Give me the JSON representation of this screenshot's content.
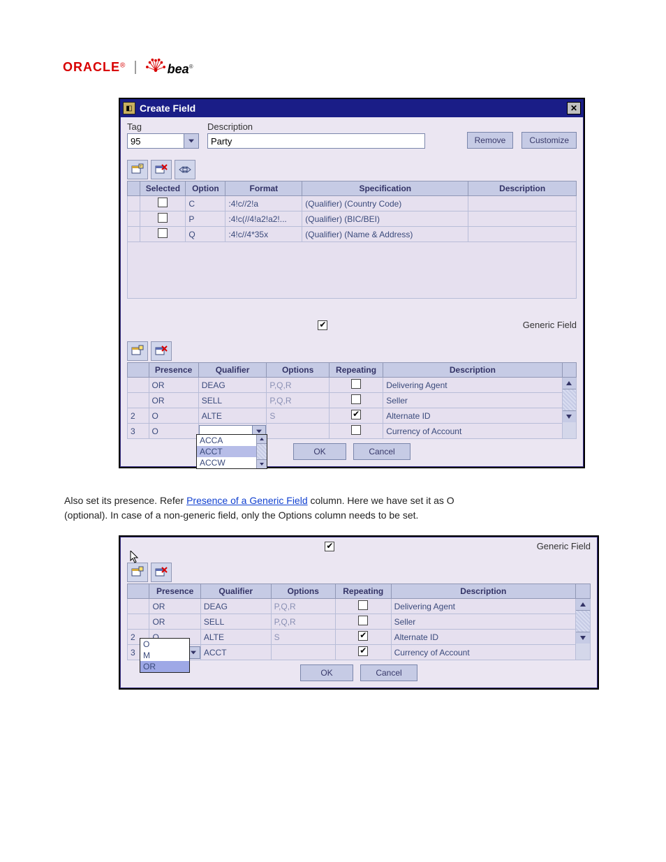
{
  "brand": {
    "oracle": "ORACLE",
    "reg": "®",
    "bea": "bea"
  },
  "dialog1": {
    "title": "Create Field",
    "tag_label": "Tag",
    "tag_value": "95",
    "desc_label": "Description",
    "desc_value": "Party",
    "remove_btn": "Remove",
    "customize_btn": "Customize",
    "th": {
      "selected": "Selected",
      "option": "Option",
      "format": "Format",
      "spec": "Specification",
      "desc": "Description"
    },
    "rows": [
      {
        "option": "C",
        "format": ":4!c//2!a",
        "spec": "(Qualifier) (Country Code)",
        "desc": ""
      },
      {
        "option": "P",
        "format": ":4!c(//4!a2!a2!...",
        "spec": "(Qualifier) (BIC/BEI)",
        "desc": ""
      },
      {
        "option": "Q",
        "format": ":4!c//4*35x",
        "spec": "(Qualifier) (Name & Address)",
        "desc": ""
      }
    ],
    "generic": "Generic Field",
    "th2": {
      "presence": "Presence",
      "qualifier": "Qualifier",
      "options": "Options",
      "repeating": "Repeating",
      "desc": "Description"
    },
    "rows2": [
      {
        "idx": "",
        "presence": "OR",
        "qualifier": "DEAG",
        "options": "P,Q,R",
        "repeating": false,
        "desc": "Delivering Agent"
      },
      {
        "idx": "",
        "presence": "OR",
        "qualifier": "SELL",
        "options": "P,Q,R",
        "repeating": false,
        "desc": "Seller"
      },
      {
        "idx": "2",
        "presence": "O",
        "qualifier": "ALTE",
        "options": "S",
        "repeating": true,
        "desc": "Alternate ID"
      },
      {
        "idx": "3",
        "presence": "O",
        "qualifier": "",
        "options": "",
        "repeating": false,
        "desc": "Currency of Account"
      }
    ],
    "qualifier_dropdown": [
      "ACCA",
      "ACCT",
      "ACCW"
    ],
    "ok": "OK",
    "cancel": "Cancel"
  },
  "paragraph": {
    "line1_a": "Also set its presence. Refer ",
    "link": "Presence of a Generic Field",
    "line1_b": " column. Here we have set it as O",
    "line2": "(optional). In case of a non-generic field, only the Options column needs to be set."
  },
  "dialog2": {
    "generic": "Generic Field",
    "th": {
      "presence": "Presence",
      "qualifier": "Qualifier",
      "options": "Options",
      "repeating": "Repeating",
      "desc": "Description"
    },
    "rows": [
      {
        "idx": "",
        "presence": "OR",
        "qualifier": "DEAG",
        "options": "P,Q,R",
        "repeating": false,
        "desc": "Delivering Agent"
      },
      {
        "idx": "",
        "presence": "OR",
        "qualifier": "SELL",
        "options": "P,Q,R",
        "repeating": false,
        "desc": "Seller"
      },
      {
        "idx": "2",
        "presence": "O",
        "qualifier": "ALTE",
        "options": "S",
        "repeating": true,
        "desc": "Alternate ID"
      },
      {
        "idx": "3",
        "presence": "O",
        "qualifier": "ACCT",
        "options": "",
        "repeating": true,
        "desc": "Currency of Account"
      }
    ],
    "presence_dropdown": [
      "O",
      "M",
      "OR"
    ],
    "ok": "OK",
    "cancel": "Cancel"
  }
}
